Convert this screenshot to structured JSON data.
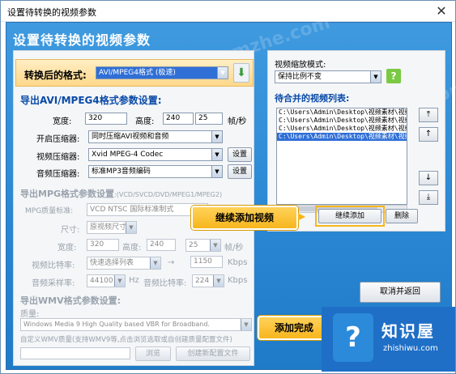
{
  "window": {
    "title": "设置待转换的视频参数",
    "close": "✕"
  },
  "header": "设置待转换的视频参数",
  "watermark": "www.wmzhe.com",
  "format": {
    "label": "转换后的格式:",
    "value": "AVI/MPEG4格式      (极速)"
  },
  "avi": {
    "title": "导出AVI/MPEG4格式参数设置:",
    "width_label": "宽度:",
    "width": "320",
    "height_label": "高度:",
    "height": "240",
    "fps": "25",
    "fps_unit": "帧/秒",
    "compress_label": "开启压缩器:",
    "compress": "同时压缩AVI视频和音频",
    "vcodec_label": "视频压缩器:",
    "vcodec": "Xvid MPEG-4 Codec",
    "vset": "设置",
    "acodec_label": "音频压缩器:",
    "acodec": "标准MP3音频编码",
    "aset": "设置"
  },
  "mpg": {
    "title": "导出MPG格式参数设置",
    "title_sub": ":(VCD/SVCD/DVD/MPEG1/MPEG2)",
    "quality_label": "MPG质量标准:",
    "quality": "VCD  NTSC 国际标准制式",
    "size_label": "尺寸:",
    "size": "原视频尺寸",
    "width_label": "宽度:",
    "width": "320",
    "height_label": "高度:",
    "height": "240",
    "fps": "25",
    "fps_unit": "帧/秒",
    "vbitrate_label": "视频比特率:",
    "vbitrate": "快速选择列表",
    "vbitrate_value": "1150",
    "vbitrate_unit": "Kbps",
    "asample_label": "音频采样率:",
    "asample": "44100",
    "asample_unit": "Hz",
    "abitrate_label": "音频比特率:",
    "abitrate": "224",
    "abitrate_unit": "Kbps"
  },
  "wmv": {
    "title": "导出WMV格式参数设置:",
    "quality_label": "质量:",
    "quality": "Windows Media 9 High Quality based VBR for Broadband.",
    "custom": "自定义WMV质量(支持WMV9等,点击浏览选取或自创建质量配置文件)",
    "browse": "浏览",
    "create": "创建新配置文件"
  },
  "scale": {
    "label": "视频缩放模式:",
    "value": "保持比例不变",
    "help": "?"
  },
  "list": {
    "title": "待合并的视频列表:",
    "items": [
      "C:\\Users\\Admin\\Desktop\\视频素材\\视频",
      "C:\\Users\\Admin\\Desktop\\视频素材\\视频",
      "C:\\Users\\Admin\\Desktop\\视频素材\\视频",
      "C:\\Users\\Admin\\Desktop\\视频素材\\视频"
    ],
    "selected_index": 3
  },
  "side_buttons": [
    "⤒",
    "↑",
    "↓",
    "⤓"
  ],
  "buttons": {
    "add_more": "继续添加",
    "delete": "删除",
    "cancel": "取消并返回"
  },
  "callouts": {
    "add_video": "继续添加视频",
    "done": "添加完成"
  },
  "logo": {
    "title": "知识屋",
    "url": "zhishiwu.com"
  },
  "colors": {
    "accent": "#2a86d2",
    "highlight": "#f7b61c"
  }
}
